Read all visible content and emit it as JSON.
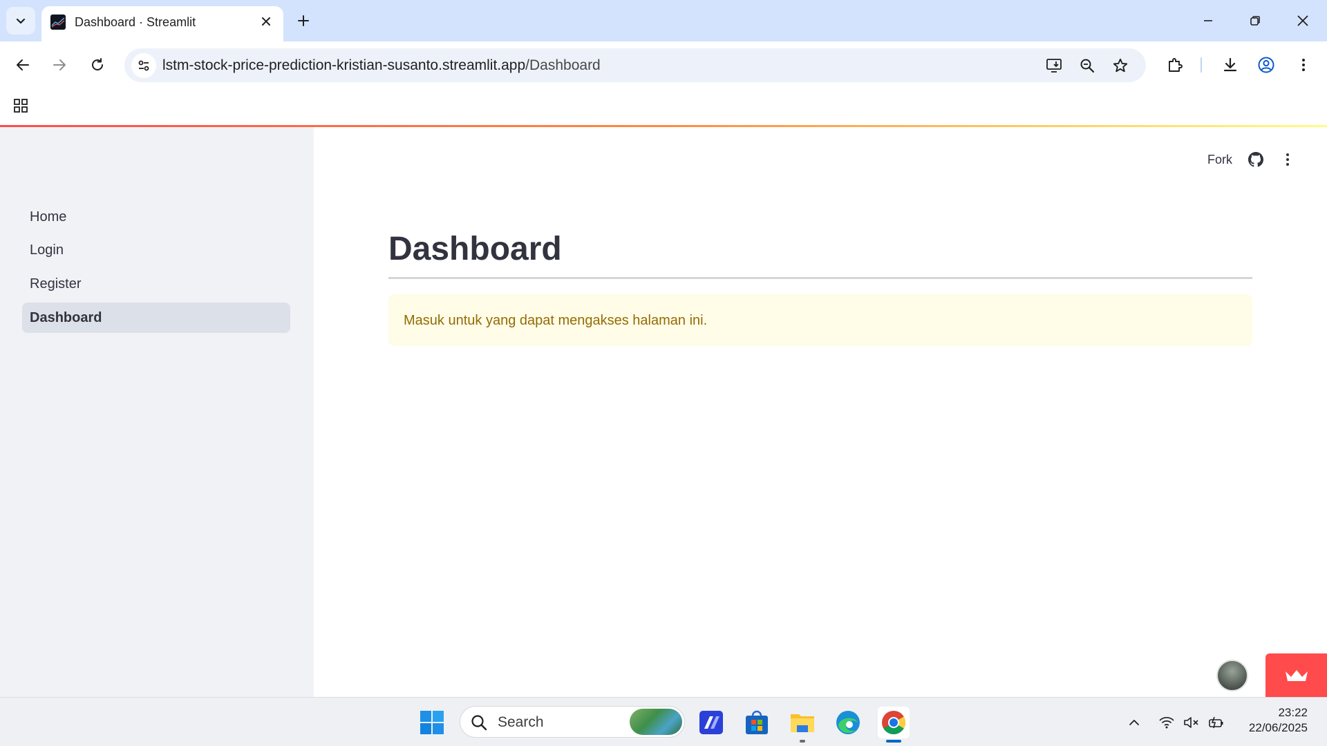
{
  "browser": {
    "tab_title": "Dashboard · Streamlit",
    "url_host": "lstm-stock-price-prediction-kristian-susanto.streamlit.app",
    "url_path": "/Dashboard"
  },
  "header": {
    "fork_label": "Fork"
  },
  "sidebar": {
    "items": [
      {
        "label": "Home",
        "active": false
      },
      {
        "label": "Login",
        "active": false
      },
      {
        "label": "Register",
        "active": false
      },
      {
        "label": "Dashboard",
        "active": true
      }
    ]
  },
  "main": {
    "title": "Dashboard",
    "warning_message": "Masuk untuk yang dapat mengakses halaman ini."
  },
  "colors": {
    "accent": "#ff4b4b",
    "sidebar_bg": "#f0f2f6",
    "warning_bg": "#fffce7",
    "warning_text": "#926c05"
  },
  "taskbar": {
    "search_placeholder": "Search",
    "apps": [
      "copilot-icon",
      "store-icon",
      "file-explorer-icon",
      "edge-icon",
      "chrome-icon"
    ],
    "time": "23:22",
    "date": "22/06/2025"
  }
}
